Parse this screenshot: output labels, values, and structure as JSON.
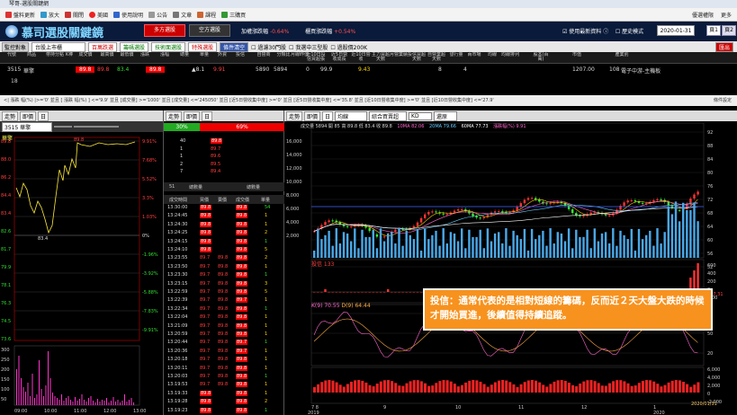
{
  "window": {
    "title": "琴哥-選股關鍵網"
  },
  "toolbar": {
    "items": [
      "盤料更新",
      "放大",
      "關閉",
      "美國",
      "使用說明",
      "公告",
      "文章",
      "課程",
      "三購買"
    ],
    "right": [
      "優選權限",
      "更多"
    ]
  },
  "app": {
    "logo": "慕司選股關鍵鏡",
    "btn_long": "多方選股",
    "btn_short": "空方選股",
    "ratio1_label": "加權漲跌幅",
    "ratio1_value": "-0.64%",
    "ratio2_label": "櫃買漲跌幅",
    "ratio2_value": "+0.54%",
    "chk_realtime": "使用最新資料",
    "chk_history": "歷史模式",
    "date": "2020-01-31",
    "tabs": [
      "頁1",
      "頁2"
    ]
  },
  "filter": {
    "label": "監控對象",
    "market": "台股上市櫃",
    "buttons": [
      "百萬跌選",
      "籌碼選股",
      "技術面選股",
      "特殊選股"
    ],
    "clear": "條件清空",
    "checks": [
      "過濾30門股",
      "我選中三型股",
      "過股價200K"
    ],
    "exit": "匯出"
  },
  "grid": {
    "headers": [
      "代號",
      "商品",
      "帶持分點",
      "K棒",
      "成交價",
      "最高價",
      "最低價",
      "漲跌",
      "漲幅",
      "總量",
      "單量",
      "外資",
      "投信",
      "自營商",
      "分類比",
      "月線昨值",
      "近10日投信買超張",
      "近5日營收成長",
      "近10日營收",
      "主力買超天數",
      "月營業績",
      "投信買超天數",
      "自營業超天數",
      "發行量",
      "兩市場",
      "均線",
      "均線排列",
      "股本(百萬)",
      "市值",
      "產業別"
    ],
    "row": {
      "code": "3515",
      "name": "華擎",
      "price": "89.8",
      "high": "89.8",
      "low": "83.4",
      "change": "▲8.1",
      "pct": "9.91",
      "vol": "5890",
      "single": "5894",
      "c1": "0",
      "c2": "99.9",
      "c3": "9.43",
      "c4": "8",
      "c5": "4",
      "capital": "1207.00",
      "mcap": "108",
      "industry": "電子中游-主機板"
    },
    "row2_count": "18"
  },
  "cond": {
    "text": "<| 漲跌 幅(%) |>='0' 並且 [ 漲跌 幅(%) ] <='9.9' 並且 [成交量] >='1000' 並且 [成交量] <='245050' 並且 [近5日營收集中度] >='0' 並且 [近5日營收集中度] <='35.8' 並且 [近10日營收集中度] >='0' 並且 [近10日營收集中度] <='27.9'",
    "right": "條件設定"
  },
  "left": {
    "tabs": [
      "走勢",
      "即價",
      "日"
    ],
    "stock": "3515 華擎",
    "label_name": "華擎",
    "price_labels_left": [
      "89.8",
      "88.0",
      "86.2",
      "84.4",
      "83.4",
      "82.6",
      "81.7",
      "79.9",
      "78.1",
      "76.3",
      "74.5",
      "73.6"
    ],
    "pct_labels": [
      "9.91%",
      "7.68%",
      "5.52%",
      "3.3%",
      "1.03%",
      "0%",
      "-1.96%",
      "-3.92%",
      "-5.88%",
      "-7.83%",
      "-9.91%"
    ],
    "hi": "89.8",
    "lo": "83.4",
    "vol_labels": [
      "300",
      "250",
      "200",
      "150",
      "100",
      "50"
    ],
    "times": [
      "09:00",
      "10:00",
      "11:00",
      "12:00",
      "13:00"
    ]
  },
  "mid": {
    "tabs": [
      "走勢",
      "即價",
      "日"
    ],
    "bar_left": "30%",
    "bar_right": "69%",
    "depth": [
      {
        "q": "40",
        "p": "89.8"
      },
      {
        "q": "1",
        "p": "89.7"
      },
      {
        "q": "1",
        "p": "89.6"
      },
      {
        "q": "2",
        "p": "89.5"
      },
      {
        "q": "7",
        "p": "89.4"
      }
    ],
    "sub_hdr": [
      "51",
      "總數量",
      "總數量"
    ],
    "tick_hdr": [
      "成交時間",
      "買價",
      "賣價",
      "成交價",
      "單量"
    ],
    "ticks": [
      [
        "13:30:00",
        "89.8",
        "",
        "89.8",
        "54"
      ],
      [
        "13:24:45",
        "89.8",
        "",
        "89.8",
        "1"
      ],
      [
        "13:24:30",
        "89.8",
        "",
        "89.8",
        "1"
      ],
      [
        "13:24:25",
        "89.8",
        "",
        "89.8",
        "2"
      ],
      [
        "13:24:15",
        "89.8",
        "",
        "89.8",
        "1"
      ],
      [
        "13:24:10",
        "89.8",
        "",
        "89.8",
        "5"
      ],
      [
        "13:23:55",
        "89.7",
        "89.8",
        "89.8",
        "2"
      ],
      [
        "13:23:50",
        "89.7",
        "89.8",
        "89.8",
        "1"
      ],
      [
        "13:23:30",
        "89.7",
        "89.8",
        "89.8",
        "1"
      ],
      [
        "13:23:15",
        "89.7",
        "89.8",
        "89.8",
        "3"
      ],
      [
        "13:22:59",
        "89.7",
        "89.8",
        "89.8",
        "5"
      ],
      [
        "13:22:39",
        "89.7",
        "89.8",
        "89.7",
        "1"
      ],
      [
        "13:22:34",
        "89.7",
        "89.8",
        "89.8",
        "1"
      ],
      [
        "13:22:04",
        "89.7",
        "89.8",
        "89.8",
        "1"
      ],
      [
        "13:21:09",
        "89.7",
        "89.8",
        "89.8",
        "1"
      ],
      [
        "13:20:59",
        "89.7",
        "89.8",
        "89.8",
        "1"
      ],
      [
        "13:20:44",
        "89.7",
        "89.8",
        "89.7",
        "1"
      ],
      [
        "13:20:36",
        "89.7",
        "89.8",
        "89.7",
        "1"
      ],
      [
        "13:20:18",
        "89.7",
        "89.8",
        "89.8",
        "1"
      ],
      [
        "13:20:11",
        "89.7",
        "89.8",
        "89.8",
        "1"
      ],
      [
        "13:20:03",
        "89.7",
        "89.8",
        "89.8",
        "1"
      ],
      [
        "13:19:53",
        "89.7",
        "89.8",
        "89.8",
        "1"
      ],
      [
        "13:19:33",
        "89.8",
        "",
        "89.8",
        "1"
      ],
      [
        "13:19:28",
        "89.8",
        "",
        "89.8",
        "2"
      ],
      [
        "13:19:23",
        "89.8",
        "",
        "89.8",
        "1"
      ]
    ]
  },
  "kchart": {
    "tabs": [
      "走勢",
      "即價",
      "日"
    ],
    "inp1": "均線",
    "inp2": "綜合買賣超",
    "inp3": "KD",
    "inp4": "還原",
    "info": "成交量 5894  開 85  高 89.8  低 83.4  收 89.8",
    "ma_labels": [
      "10MA 82.06",
      "20MA 79.66",
      "60MA 77.73"
    ],
    "chg": "漲跌幅(%) 9.91",
    "inst_label": "投信 133",
    "kd_label": "K(9) 70.55",
    "kd_label2": "D(9) 64.44",
    "price_axis": [
      "92",
      "88",
      "84",
      "80",
      "76",
      "72",
      "68",
      "64",
      "60",
      "56",
      "52"
    ],
    "vol_axis": [
      "16,000",
      "14,000",
      "12,000",
      "10,000",
      "8,000",
      "6,000",
      "4,000",
      "2,000"
    ],
    "inst_axis": [
      "600",
      "400",
      "200",
      "0",
      "-200"
    ],
    "inst_tag": "287.31",
    "kd_axis": [
      "80",
      "50",
      "20"
    ],
    "bot_axis": [
      "6,000",
      "4,000",
      "2,000",
      "0",
      "-2,000"
    ],
    "months": [
      "7 8",
      "9",
      "10",
      "11",
      "12",
      "1"
    ],
    "years": [
      "2019",
      "2020"
    ],
    "date_tag": "2020/01/31"
  },
  "callout": "投信：通常代表的是相對短線的籌碼，反而近２天大盤大跌的時候才開始買進，後續值得持續追蹤。"
}
